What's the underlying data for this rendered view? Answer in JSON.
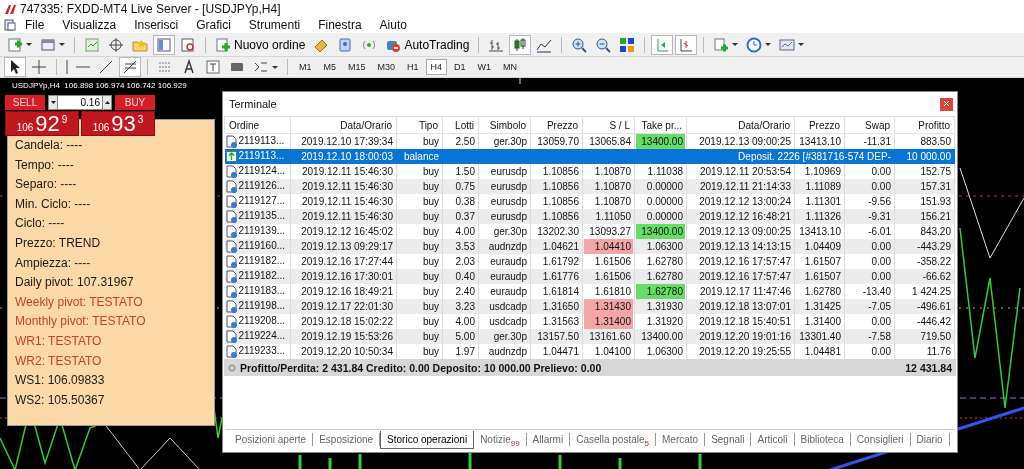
{
  "window": {
    "title": "747335: FXDD-MT4 Live Server - [USDJPYp,H4]"
  },
  "menu": [
    "File",
    "Visualizza",
    "Inserisci",
    "Grafici",
    "Strumenti",
    "Finestra",
    "Aiuto"
  ],
  "toolbar": {
    "new_order": "Nuovo ordine",
    "autotrading": "AutoTrading"
  },
  "timeframes": [
    {
      "label": "M1",
      "selected": false
    },
    {
      "label": "M5",
      "selected": false
    },
    {
      "label": "M15",
      "selected": false
    },
    {
      "label": "M30",
      "selected": false
    },
    {
      "label": "H1",
      "selected": false
    },
    {
      "label": "H4",
      "selected": true
    },
    {
      "label": "D1",
      "selected": false
    },
    {
      "label": "W1",
      "selected": false
    },
    {
      "label": "MN",
      "selected": false
    }
  ],
  "chart": {
    "header": "USDJPYp,H4  106.898 106.974 106.742 106.929"
  },
  "trade_panel": {
    "sell": "SELL",
    "lot": "0.16",
    "buy": "BUY",
    "bid": {
      "big": "106",
      "main": "92",
      "sup": "9"
    },
    "ask": {
      "big": "106",
      "main": "93",
      "sup": "3"
    }
  },
  "info_lines": [
    {
      "text": "Candela: ----",
      "color": "#1a1a1a"
    },
    {
      "text": "Tempo: ----",
      "color": "#1a1a1a"
    },
    {
      "text": "Separo: ----",
      "color": "#1a1a1a"
    },
    {
      "text": "Min. Ciclo: ----",
      "color": "#1a1a1a"
    },
    {
      "text": "Ciclo: ----",
      "color": "#1a1a1a"
    },
    {
      "text": "Prezzo: TREND",
      "color": "#1a1a1a"
    },
    {
      "text": "Ampiezza: ----",
      "color": "#1a1a1a"
    },
    {
      "text": "Daily pivot: 107.31967",
      "color": "#1a1a1a"
    },
    {
      "text": "Weekly pivot: TESTATO",
      "color": "#c8402c"
    },
    {
      "text": "Monthly pivot: TESTATO",
      "color": "#c8402c"
    },
    {
      "text": "WR1: TESTATO",
      "color": "#c8402c"
    },
    {
      "text": "WR2: TESTATO",
      "color": "#c8402c"
    },
    {
      "text": "WS1: 106.09833",
      "color": "#1a1a1a"
    },
    {
      "text": "WS2: 105.50367",
      "color": "#1a1a1a"
    }
  ],
  "terminal": {
    "title": "Terminale",
    "columns": [
      "Ordine",
      "Data/Orario",
      "Tipo",
      "Lotti",
      "Simbolo",
      "Prezzo",
      "S / L",
      "Take pr...",
      "Data/Orario",
      "Prezzo",
      "Swap",
      "Profitto"
    ],
    "rows": [
      {
        "kind": "order",
        "selected": false,
        "sl_hit": false,
        "tp_hit": true,
        "cells": [
          "2119113...",
          "2019.12.10 17:39:34",
          "buy",
          "2.50",
          "ger.30p",
          "13059.70",
          "13065.84",
          "13400.00",
          "2019.12.13 09:00:25",
          "13413.10",
          "-11.31",
          "883.50"
        ]
      },
      {
        "kind": "balance",
        "selected": true,
        "cells": [
          "2119113...",
          "2019.12.10 18:00:03",
          "balance"
        ],
        "comment": "Deposit. 2226 [#381716-574 DEP-",
        "profit": "10 000.00"
      },
      {
        "kind": "order",
        "selected": false,
        "sl_hit": false,
        "tp_hit": false,
        "cells": [
          "2119124...",
          "2019.12.11 15:46:30",
          "buy",
          "1.50",
          "eurusdp",
          "1.10856",
          "1.10870",
          "1.11038",
          "2019.12.11 20:53:54",
          "1.10969",
          "0.00",
          "152.75"
        ]
      },
      {
        "kind": "order",
        "selected": false,
        "sl_hit": false,
        "tp_hit": false,
        "cells": [
          "2119126...",
          "2019.12.11 15:46:30",
          "buy",
          "0.75",
          "eurusdp",
          "1.10856",
          "1.10870",
          "0.00000",
          "2019.12.11 21:14:33",
          "1.11089",
          "0.00",
          "157.31"
        ]
      },
      {
        "kind": "order",
        "selected": false,
        "sl_hit": false,
        "tp_hit": false,
        "cells": [
          "2119127...",
          "2019.12.11 15:46:30",
          "buy",
          "0.38",
          "eurusdp",
          "1.10856",
          "1.10870",
          "0.00000",
          "2019.12.12 13:00:24",
          "1.11301",
          "-9.56",
          "151.93"
        ]
      },
      {
        "kind": "order",
        "selected": false,
        "sl_hit": false,
        "tp_hit": false,
        "cells": [
          "2119135...",
          "2019.12.11 15:46:30",
          "buy",
          "0.37",
          "eurusdp",
          "1.10856",
          "1.11050",
          "0.00000",
          "2019.12.12 16:48:21",
          "1.11326",
          "-9.31",
          "156.21"
        ]
      },
      {
        "kind": "order",
        "selected": false,
        "sl_hit": false,
        "tp_hit": true,
        "cells": [
          "2119139...",
          "2019.12.12 16:45:02",
          "buy",
          "4.00",
          "ger.30p",
          "13202.30",
          "13093.27",
          "13400.00",
          "2019.12.13 09:00:25",
          "13413.10",
          "-6.01",
          "843.20"
        ]
      },
      {
        "kind": "order",
        "selected": false,
        "sl_hit": true,
        "tp_hit": false,
        "cells": [
          "2119160...",
          "2019.12.13 09:29:17",
          "buy",
          "3.53",
          "audnzdp",
          "1.04621",
          "1.04410",
          "1.06300",
          "2019.12.13 14:13:15",
          "1.04409",
          "0.00",
          "-443.29"
        ]
      },
      {
        "kind": "order",
        "selected": false,
        "sl_hit": false,
        "tp_hit": false,
        "cells": [
          "2119182...",
          "2019.12.16 17:27:44",
          "buy",
          "2.03",
          "euraudp",
          "1.61792",
          "1.61506",
          "1.62780",
          "2019.12.16 17:57:47",
          "1.61507",
          "0.00",
          "-358.22"
        ]
      },
      {
        "kind": "order",
        "selected": false,
        "sl_hit": false,
        "tp_hit": false,
        "cells": [
          "2119182...",
          "2019.12.16 17:30:01",
          "buy",
          "0.40",
          "euraudp",
          "1.61776",
          "1.61506",
          "1.62780",
          "2019.12.16 17:57:47",
          "1.61507",
          "0.00",
          "-66.62"
        ]
      },
      {
        "kind": "order",
        "selected": false,
        "sl_hit": false,
        "tp_hit": true,
        "cells": [
          "2119183...",
          "2019.12.16 18:49:21",
          "buy",
          "2.40",
          "euraudp",
          "1.61814",
          "1.61810",
          "1.62780",
          "2019.12.17 11:47:46",
          "1.62780",
          "-13.40",
          "1 424.25"
        ]
      },
      {
        "kind": "order",
        "selected": false,
        "sl_hit": true,
        "tp_hit": false,
        "cells": [
          "2119198...",
          "2019.12.17 22:01:30",
          "buy",
          "3.23",
          "usdcadp",
          "1.31650",
          "1.31430",
          "1.31930",
          "2019.12.18 13:07:01",
          "1.31425",
          "-7.05",
          "-496.61"
        ]
      },
      {
        "kind": "order",
        "selected": false,
        "sl_hit": true,
        "tp_hit": false,
        "cells": [
          "2119208...",
          "2019.12.18 15:02:22",
          "buy",
          "4.00",
          "usdcadp",
          "1.31563",
          "1.31400",
          "1.31920",
          "2019.12.18 15:40:51",
          "1.31400",
          "0.00",
          "-446.42"
        ]
      },
      {
        "kind": "order",
        "selected": false,
        "sl_hit": false,
        "tp_hit": false,
        "cells": [
          "2119224...",
          "2019.12.19 15:53:26",
          "buy",
          "5.00",
          "ger.30p",
          "13157.50",
          "13161.60",
          "13400.00",
          "2019.12.20 19:01:16",
          "13301.40",
          "-7.58",
          "719.50"
        ]
      },
      {
        "kind": "order",
        "selected": false,
        "sl_hit": false,
        "tp_hit": false,
        "cells": [
          "2119233...",
          "2019.12.20 10:50:34",
          "buy",
          "1.97",
          "audnzdp",
          "1.04471",
          "1.04100",
          "1.06300",
          "2019.12.20 19:25:55",
          "1.04481",
          "0.00",
          "11.76"
        ]
      }
    ],
    "summary": "Profitto/Perdita: 2 431.84  Credito: 0.00  Deposito: 10 000.00  Prelievo: 0.00",
    "total": "12 431.84",
    "tabs": [
      {
        "label": "Posizioni aperte",
        "selected": false
      },
      {
        "label": "Esposizione",
        "selected": false
      },
      {
        "label": "Storico operazioni",
        "selected": true
      },
      {
        "label": "Notizie",
        "badge": "99",
        "selected": false
      },
      {
        "label": "Allarmi",
        "selected": false
      },
      {
        "label": "Casella postale",
        "badge": "5",
        "selected": false
      },
      {
        "label": "Mercato",
        "selected": false
      },
      {
        "label": "Segnali",
        "selected": false
      },
      {
        "label": "Articoli",
        "selected": false
      },
      {
        "label": "Biblioteca",
        "selected": false
      },
      {
        "label": "Consiglieri",
        "selected": false
      },
      {
        "label": "Diario",
        "selected": false
      }
    ]
  }
}
